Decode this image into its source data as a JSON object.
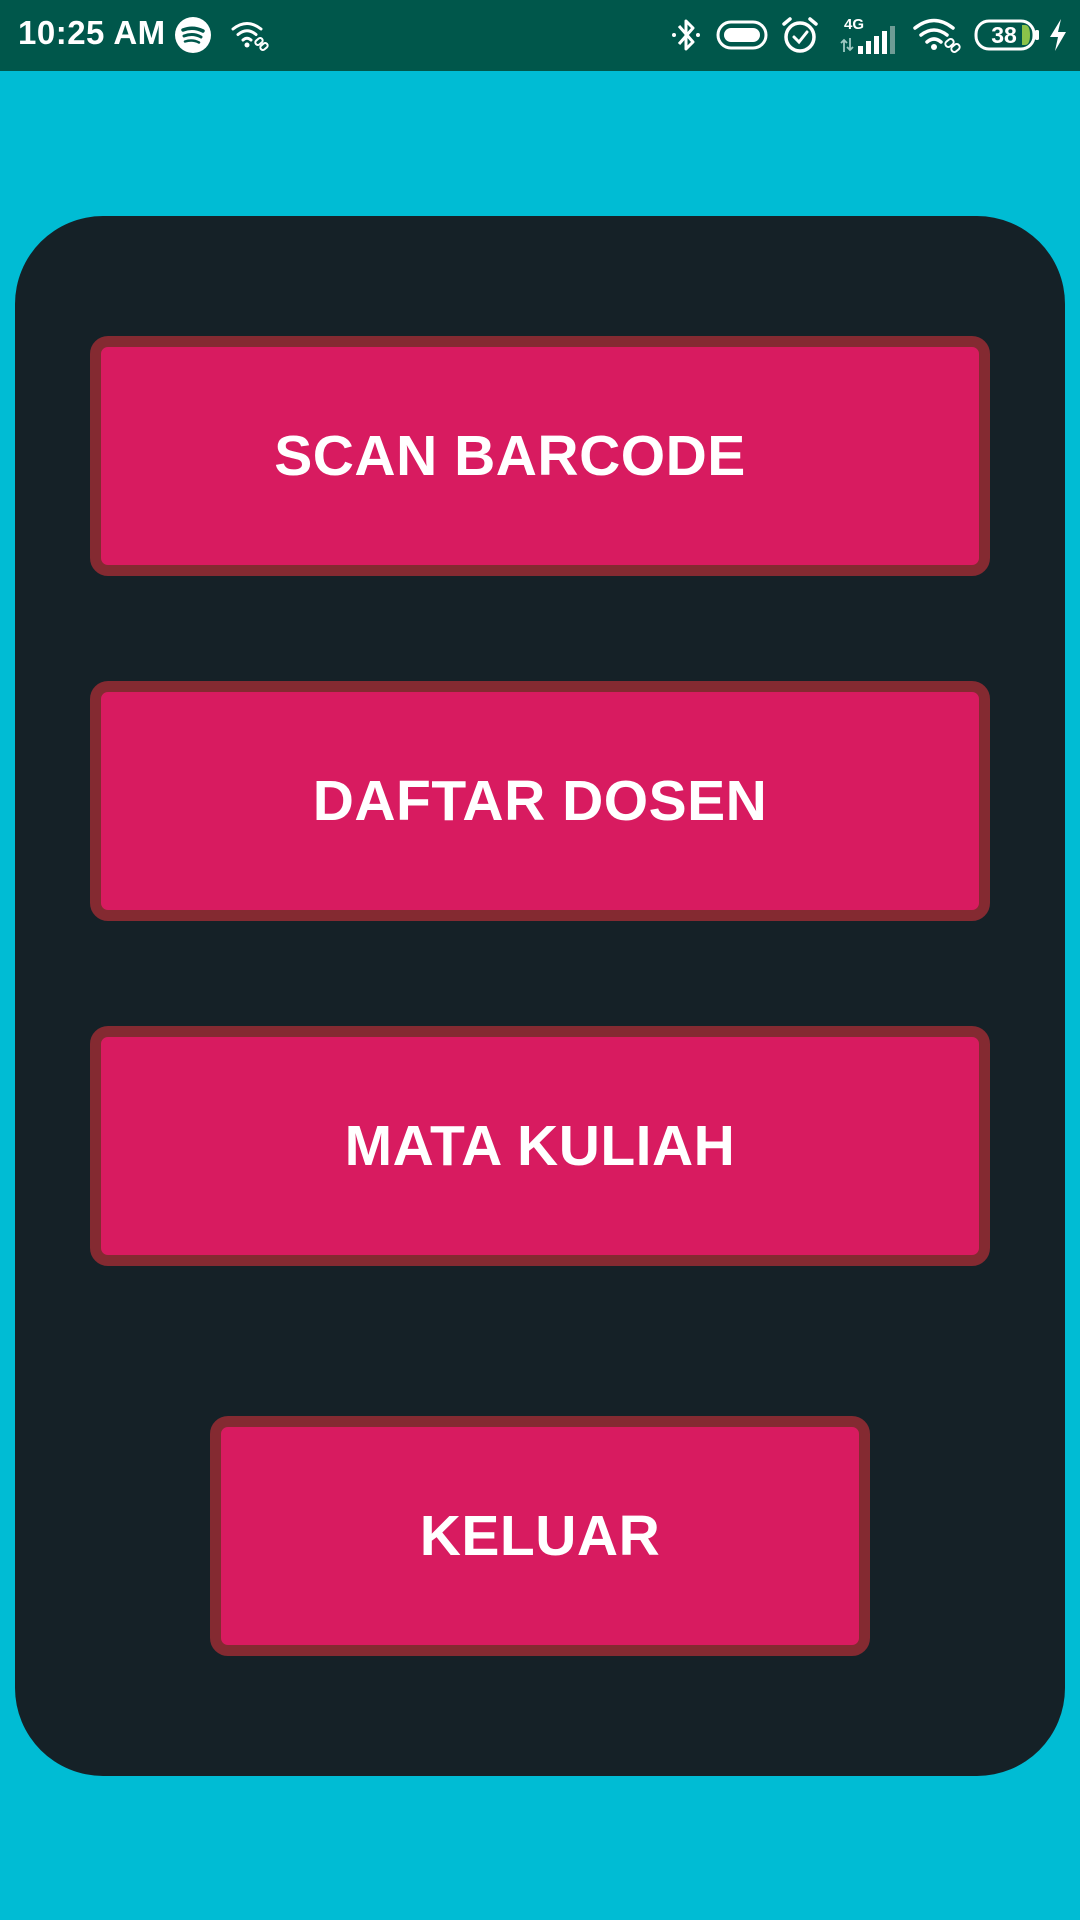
{
  "status_bar": {
    "time": "10:25 AM",
    "battery_level": "38",
    "network_type": "4G",
    "icons": [
      "spotify-icon",
      "wifi-hotspot-icon",
      "bluetooth-icon",
      "toggle-icon",
      "alarm-icon",
      "signal-icon",
      "wifi-icon",
      "battery-icon",
      "charging-icon"
    ]
  },
  "menu": {
    "scan_barcode": "SCAN BARCODE",
    "daftar_dosen": "DAFTAR DOSEN",
    "mata_kuliah": "MATA KULIAH",
    "keluar": "KELUAR"
  },
  "colors": {
    "background": "#00BCD4",
    "status_bar": "#00574B",
    "panel": "#152127",
    "button_fill": "#D81B60",
    "button_border": "#842A31",
    "battery_charge": "#8BC34A"
  }
}
